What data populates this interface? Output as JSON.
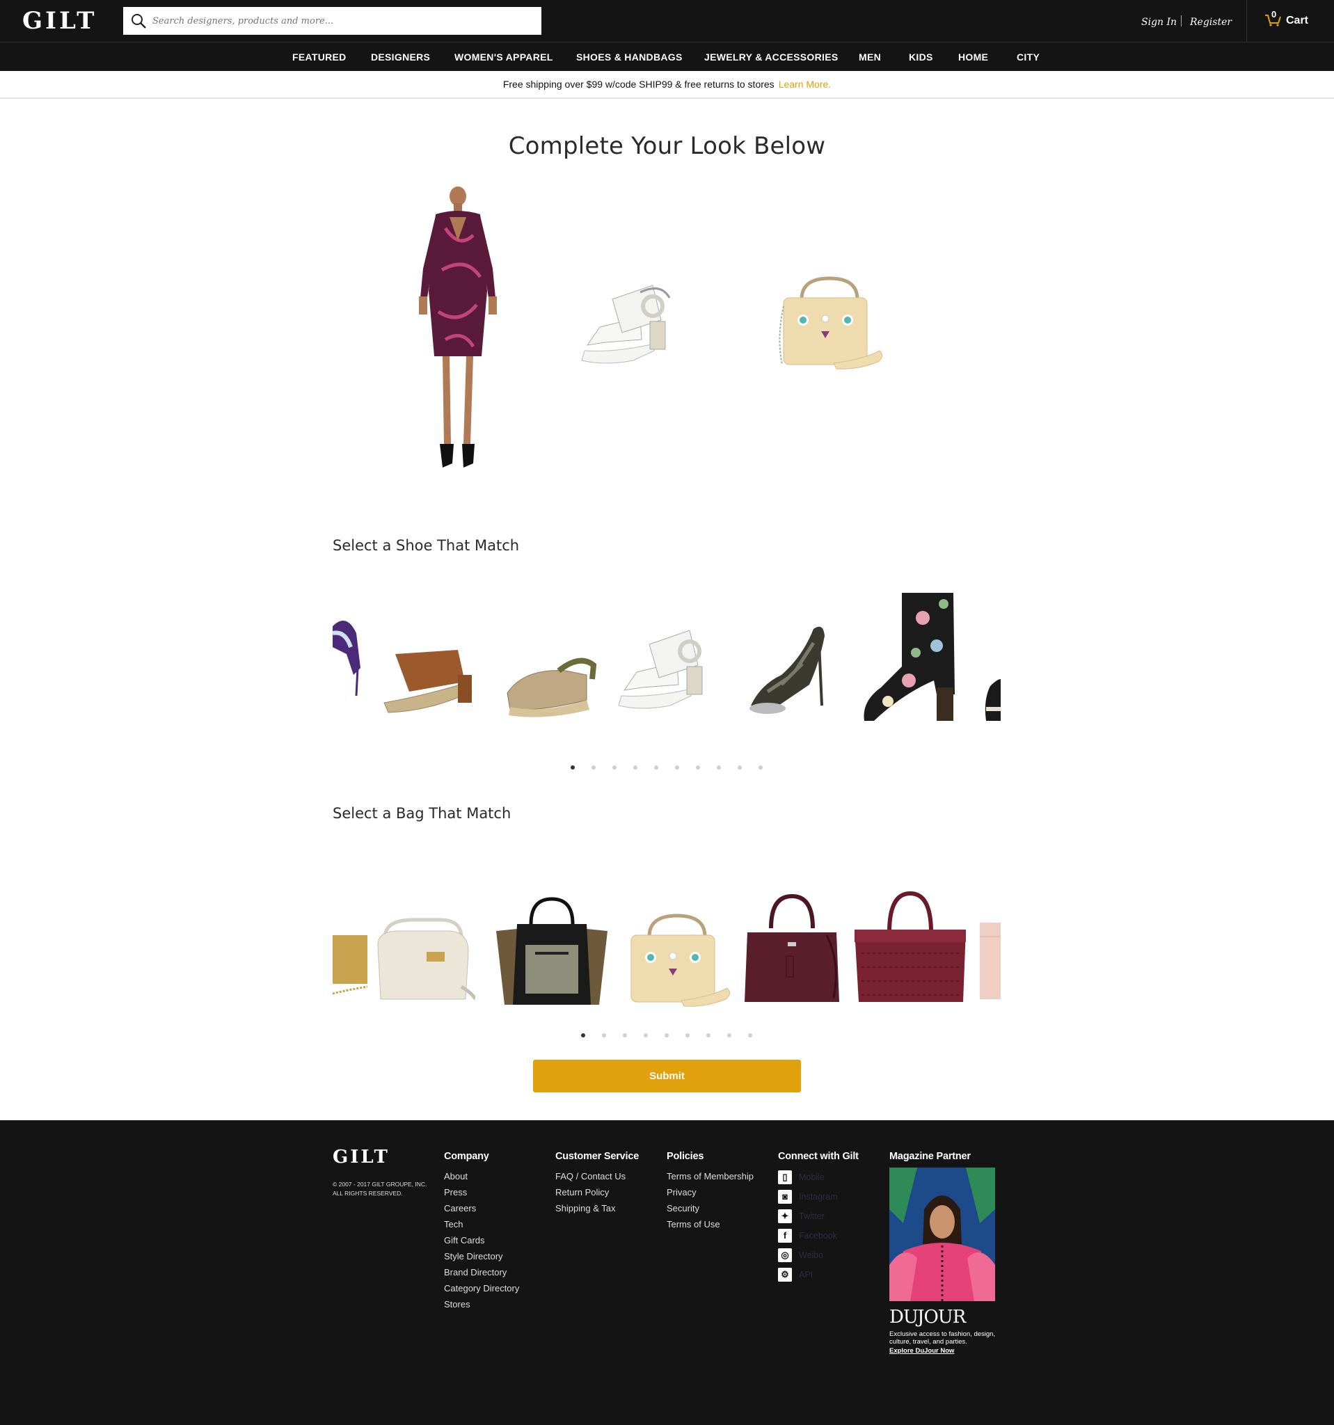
{
  "header": {
    "logo": "GILT",
    "search_placeholder": "Search designers, products and more...",
    "sign_in": "Sign In",
    "register": "Register",
    "cart_count": "0",
    "cart_label": "Cart"
  },
  "nav": [
    "FEATURED",
    "DESIGNERS",
    "WOMEN'S APPAREL",
    "SHOES & HANDBAGS",
    "JEWELRY & ACCESSORIES",
    "MEN",
    "KIDS",
    "HOME",
    "CITY"
  ],
  "promo": {
    "text": "Free shipping over $99 w/code SHIP99 & free returns to stores",
    "link": "Learn More."
  },
  "main": {
    "title": "Complete Your Look Below",
    "look_items": [
      "dress",
      "white-sandal",
      "face-bag"
    ],
    "shoe_section": {
      "title": "Select a Shoe That Match",
      "items": [
        "purple-strappy-heel",
        "tan-mule",
        "espadrille",
        "white-sandal",
        "embellished-heel",
        "floral-bootie",
        "black-loafer"
      ],
      "dot_count": 10,
      "active_dot": 0
    },
    "bag_section": {
      "title": "Select a Bag That Match",
      "items": [
        "gold-clutch",
        "cream-saddle-bag",
        "black-tote",
        "face-bag",
        "burgundy-satchel",
        "monogram-tote",
        "pink-clutch"
      ],
      "dot_count": 9,
      "active_dot": 0
    },
    "submit_label": "Submit"
  },
  "footer": {
    "logo": "GILT",
    "copyright_line1": "© 2007 - 2017 GILT GROUPE, INC.",
    "copyright_line2": "ALL RIGHTS RESERVED.",
    "columns": [
      {
        "title": "Company",
        "links": [
          "About",
          "Press",
          "Careers",
          "Tech",
          "Gift Cards",
          "Style Directory",
          "Brand Directory",
          "Category Directory",
          "Stores"
        ]
      },
      {
        "title": "Customer Service",
        "links": [
          "FAQ / Contact Us",
          "Return Policy",
          "Shipping & Tax"
        ]
      },
      {
        "title": "Policies",
        "links": [
          "Terms of Membership",
          "Privacy",
          "Security",
          "Terms of Use"
        ]
      }
    ],
    "connect": {
      "title": "Connect with Gilt",
      "items": [
        "Mobile",
        "Instagram",
        "Twitter",
        "Facebook",
        "Weibo",
        "API"
      ]
    },
    "magazine": {
      "title": "Magazine Partner",
      "logo": "DUJOUR",
      "tagline": "Exclusive access to fashion, design, culture, travel, and parties.",
      "link": "Explore DuJour Now"
    }
  },
  "colors": {
    "header_bg": "#141414",
    "accent": "#e0a10d",
    "footer_bg": "#141414"
  }
}
